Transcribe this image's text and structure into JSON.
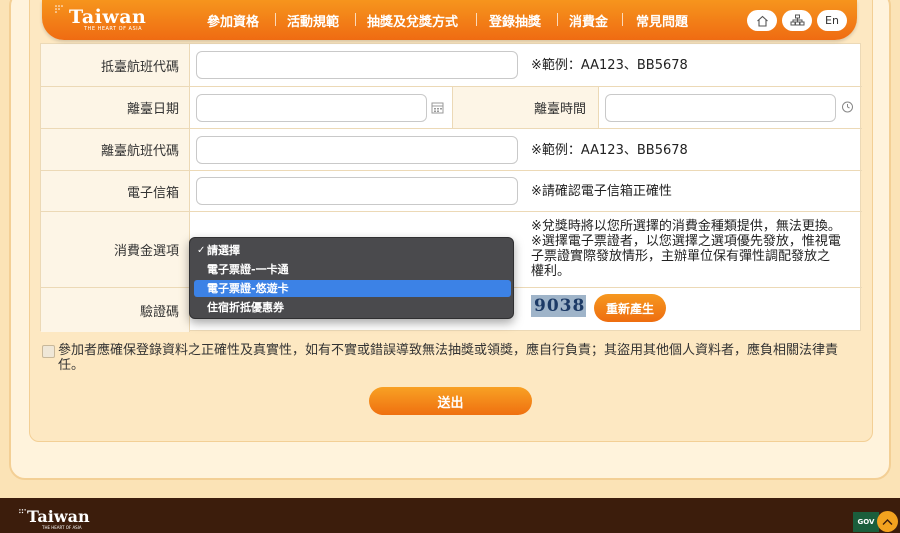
{
  "header": {
    "logo": "Taiwan",
    "logo_tagline": "THE HEART OF ASIA",
    "nav": [
      "參加資格",
      "活動規範",
      "抽獎及兌獎方式",
      "登錄抽獎",
      "消費金",
      "常見問題"
    ],
    "lang_button": "En",
    "home_icon": "home-icon",
    "sitemap_icon": "sitemap-icon"
  },
  "form": {
    "departure_flight": {
      "label": "抵臺航班代碼",
      "value": "",
      "hint": "※範例：AA123、BB5678"
    },
    "leave_date": {
      "label": "離臺日期",
      "value": "",
      "icon": "calendar-icon"
    },
    "leave_time": {
      "label": "離臺時間",
      "value": "",
      "icon": "clock-icon"
    },
    "leave_flight": {
      "label": "離臺航班代碼",
      "value": "",
      "hint": "※範例：AA123、BB5678"
    },
    "email": {
      "label": "電子信箱",
      "value": "",
      "hint": "※請確認電子信箱正確性"
    },
    "voucher": {
      "label": "消費金選項",
      "hint_line1": "※兌獎時將以您所選擇的消費金種類提供，無法更換。",
      "hint_line2": "※選擇電子票證者，以您選擇之選項優先發放，惟視電",
      "hint_line3": "子票證實際發放情形，主辦單位保有彈性調配發放之",
      "hint_line4": "權利。",
      "options": [
        "請選擇",
        "電子票證-一卡通",
        "電子票證-悠遊卡",
        "住宿折抵優惠券"
      ],
      "checked_option": "請選擇",
      "highlighted_option": "電子票證-悠遊卡"
    },
    "captcha": {
      "label": "驗證碼",
      "image_text": "9038",
      "regenerate_label": "重新產生"
    }
  },
  "agreement": {
    "text": "參加者應確保登錄資料之正確性及真實性，如有不實或錯誤導致無法抽獎或領獎，應自行負責；其盜用其他個人資料者，應負相關法律責任。",
    "checked": false
  },
  "submit_label": "送出",
  "footer": {
    "logo": "Taiwan",
    "logo_tagline": "THE HEART OF ASIA",
    "gov_badge": "GOV",
    "back_to_top_icon": "chevron-up-icon"
  },
  "colors": {
    "accent_orange": "#ef6b12",
    "footer_brown": "#3c1d0c",
    "selection_blue": "#3c82e6"
  }
}
